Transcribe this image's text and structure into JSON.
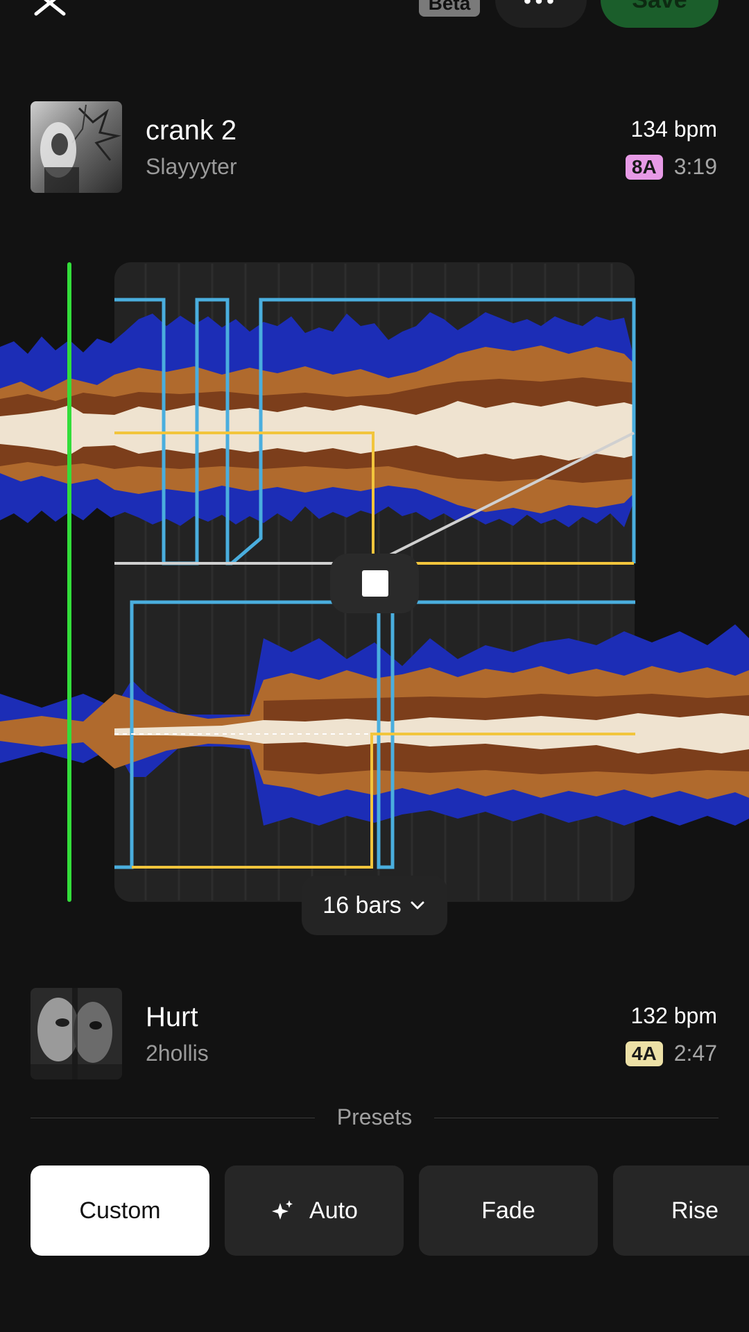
{
  "header": {
    "beta_label": "Beta",
    "more_label": "•••",
    "save_label": "Save"
  },
  "track_a": {
    "title": "crank 2",
    "artist": "Slayyyter",
    "bpm": "134 bpm",
    "key": "8A",
    "key_color": "#e79ae6",
    "duration": "3:19"
  },
  "track_b": {
    "title": "Hurt",
    "artist": "2hollis",
    "bpm": "132 bpm",
    "key": "4A",
    "key_color": "#ece0a6",
    "duration": "2:47"
  },
  "transition": {
    "bars_label": "16 bars",
    "playhead_color": "#33dd3a",
    "curve_colors": {
      "volume": "#4aaede",
      "bass": "#f2c53c",
      "eq": "#d0d0d0"
    }
  },
  "presets": {
    "label": "Presets",
    "items": [
      {
        "label": "Custom",
        "active": true
      },
      {
        "label": "Auto",
        "icon": "sparkle-icon"
      },
      {
        "label": "Fade"
      },
      {
        "label": "Rise"
      }
    ]
  }
}
